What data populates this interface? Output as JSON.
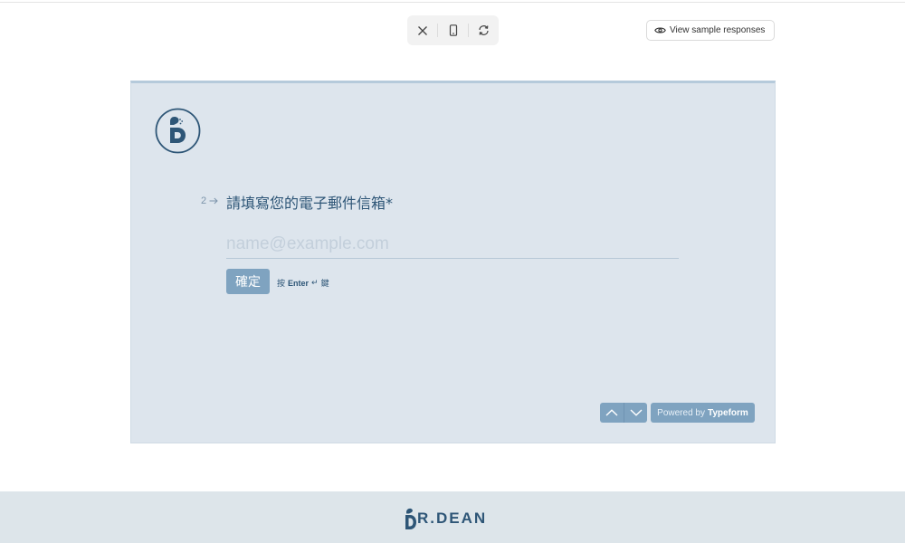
{
  "toolbar": {
    "close_icon": "close-icon",
    "mobile_icon": "mobile-device-icon",
    "refresh_icon": "refresh-icon"
  },
  "sample": {
    "label": "View sample responses",
    "icon": "eye-icon"
  },
  "form": {
    "question_number": "2",
    "question_title": "請填寫您的電子郵件信箱*",
    "email_value": "",
    "email_placeholder": "name@example.com",
    "ok_label": "確定",
    "hint_prefix": "按",
    "hint_key": "Enter",
    "hint_symbol": "↵",
    "hint_suffix": "鍵",
    "powered_prefix": "Powered by",
    "powered_brand": "Typeform"
  },
  "footer": {
    "brand_text": "R.DEAN"
  },
  "colors": {
    "form_bg": "#dde5ed",
    "accent": "#7fa3c0",
    "text": "#2e5677",
    "footer_bg": "#dde5ea"
  }
}
